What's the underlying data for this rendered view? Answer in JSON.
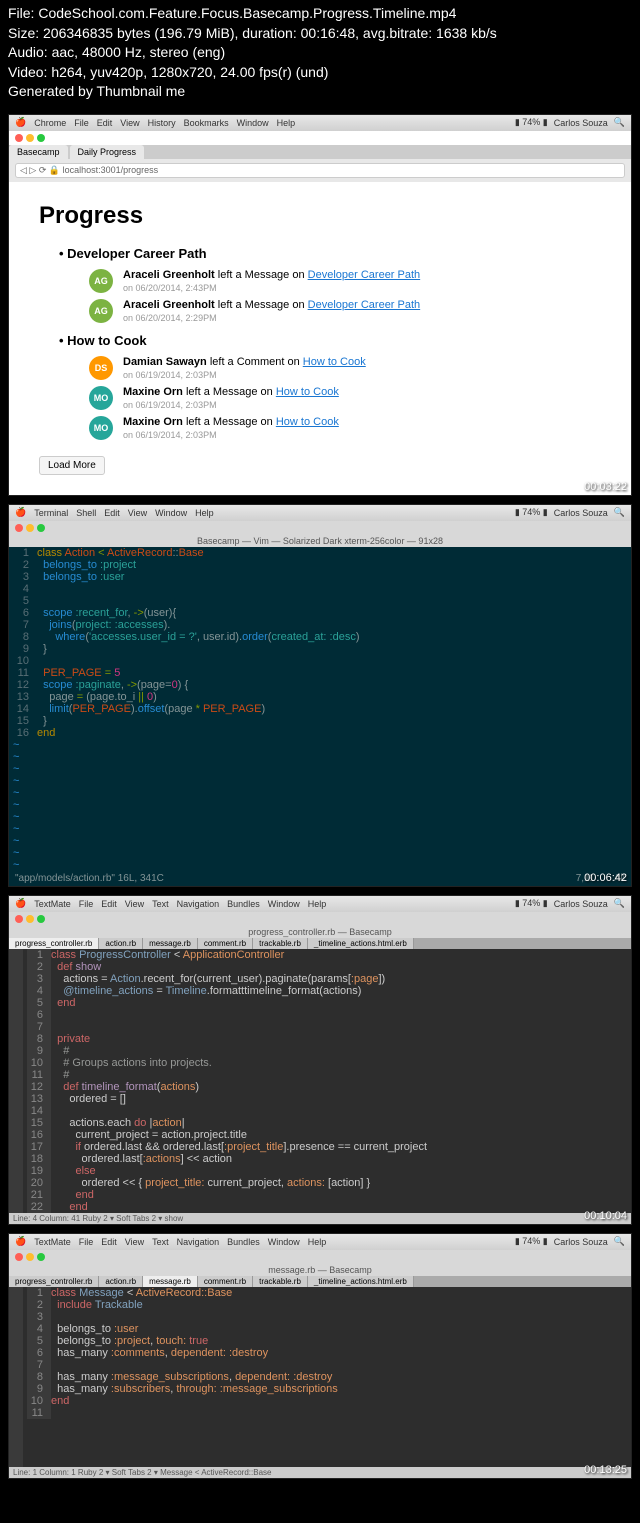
{
  "meta": {
    "l1": "File: CodeSchool.com.Feature.Focus.Basecamp.Progress.Timeline.mp4",
    "l2": "Size: 206346835 bytes (196.79 MiB), duration: 00:16:48, avg.bitrate: 1638 kb/s",
    "l3": "Audio: aac, 48000 Hz, stereo (eng)",
    "l4": "Video: h264, yuv420p, 1280x720, 24.00 fps(r) (und)",
    "l5": "Generated by Thumbnail me"
  },
  "menubar": {
    "chrome": [
      "Chrome",
      "File",
      "Edit",
      "View",
      "History",
      "Bookmarks",
      "Window",
      "Help"
    ],
    "terminal": [
      "Terminal",
      "Shell",
      "Edit",
      "View",
      "Window",
      "Help"
    ],
    "textmate": [
      "TextMate",
      "File",
      "Edit",
      "View",
      "Text",
      "Navigation",
      "Bundles",
      "Window",
      "Help"
    ],
    "user": "Carlos Souza"
  },
  "p1": {
    "ts": "00:03:22",
    "tabs": [
      "Basecamp",
      "Daily Progress"
    ],
    "url": "localhost:3001/progress",
    "title": "Progress",
    "projects": [
      {
        "name": "Developer Career Path",
        "items": [
          {
            "av": "AG",
            "cls": "av-g",
            "who": "Araceli Greenholt",
            "act": "left a Message on",
            "link": "Developer Career Path",
            "time": "on 06/20/2014, 2:43PM"
          },
          {
            "av": "AG",
            "cls": "av-g",
            "who": "Araceli Greenholt",
            "act": "left a Message on",
            "link": "Developer Career Path",
            "time": "on 06/20/2014, 2:29PM"
          }
        ]
      },
      {
        "name": "How to Cook",
        "items": [
          {
            "av": "DS",
            "cls": "av-o",
            "who": "Damian Sawayn",
            "act": "left a Comment on",
            "link": "How to Cook",
            "time": "on 06/19/2014, 2:03PM"
          },
          {
            "av": "MO",
            "cls": "av-t",
            "who": "Maxine Orn",
            "act": "left a Message on",
            "link": "How to Cook",
            "time": "on 06/19/2014, 2:03PM"
          },
          {
            "av": "MO",
            "cls": "av-t",
            "who": "Maxine Orn",
            "act": "left a Message on",
            "link": "How to Cook",
            "time": "on 06/19/2014, 2:03PM"
          }
        ]
      }
    ],
    "load": "Load More"
  },
  "p2": {
    "ts": "00:06:42",
    "title": "Basecamp — Vim — Solarized Dark xterm-256color — 91x28",
    "status_l": "\"app/models/action.rb\" 16L, 341C",
    "status_r1": "7,11",
    "status_r2": "All"
  },
  "p3": {
    "ts": "00:10:04",
    "title": "progress_controller.rb — Basecamp",
    "tabs": [
      "progress_controller.rb",
      "action.rb",
      "message.rb",
      "comment.rb",
      "trackable.rb",
      "_timeline_actions.html.erb"
    ],
    "status": "Line: 4  Column: 41    Ruby    2 ▾  Soft Tabs    2 ▾   show"
  },
  "p4": {
    "ts": "00:13:25",
    "title": "message.rb — Basecamp",
    "tabs": [
      "progress_controller.rb",
      "action.rb",
      "message.rb",
      "comment.rb",
      "trackable.rb",
      "_timeline_actions.html.erb"
    ],
    "status": "Line: 1  Column: 1    Ruby    2 ▾  Soft Tabs    2 ▾  Message < ActiveRecord::Base"
  }
}
